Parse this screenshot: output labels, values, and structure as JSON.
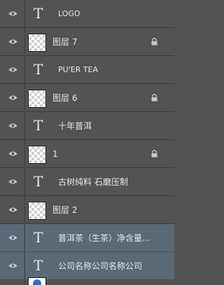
{
  "layers": [
    {
      "type": "text",
      "label": "LOGO",
      "locked": false,
      "selected": false,
      "visible_icon": "eye-icon"
    },
    {
      "type": "image",
      "label": "图层 7",
      "locked": true,
      "selected": false,
      "visible_icon": "eye-icon"
    },
    {
      "type": "text",
      "label": "PU'ER TEA",
      "locked": false,
      "selected": false,
      "visible_icon": "eye-icon"
    },
    {
      "type": "image",
      "label": "图层 6",
      "locked": true,
      "selected": false,
      "visible_icon": "eye-icon"
    },
    {
      "type": "text",
      "label": "十年普洱",
      "locked": false,
      "selected": false,
      "visible_icon": "eye-icon"
    },
    {
      "type": "image",
      "label": "1",
      "locked": true,
      "selected": false,
      "visible_icon": "eye-icon"
    },
    {
      "type": "text",
      "label": "古树纯料  石磨压制",
      "locked": false,
      "selected": false,
      "visible_icon": "eye-icon"
    },
    {
      "type": "image",
      "label": "图层 2",
      "locked": false,
      "selected": false,
      "visible_icon": "eye-icon"
    },
    {
      "type": "text",
      "label": "普洱茶（生茶）净含量...",
      "locked": false,
      "selected": true,
      "visible_icon": "eye-icon"
    },
    {
      "type": "text",
      "label": "公司名称公司名称公司",
      "locked": false,
      "selected": true,
      "visible_icon": "eye-icon"
    }
  ],
  "text_glyph": "T",
  "colors": {
    "panel_bg": "#535353",
    "selected_bg": "#5b6878",
    "divider": "#3a3a3a"
  }
}
